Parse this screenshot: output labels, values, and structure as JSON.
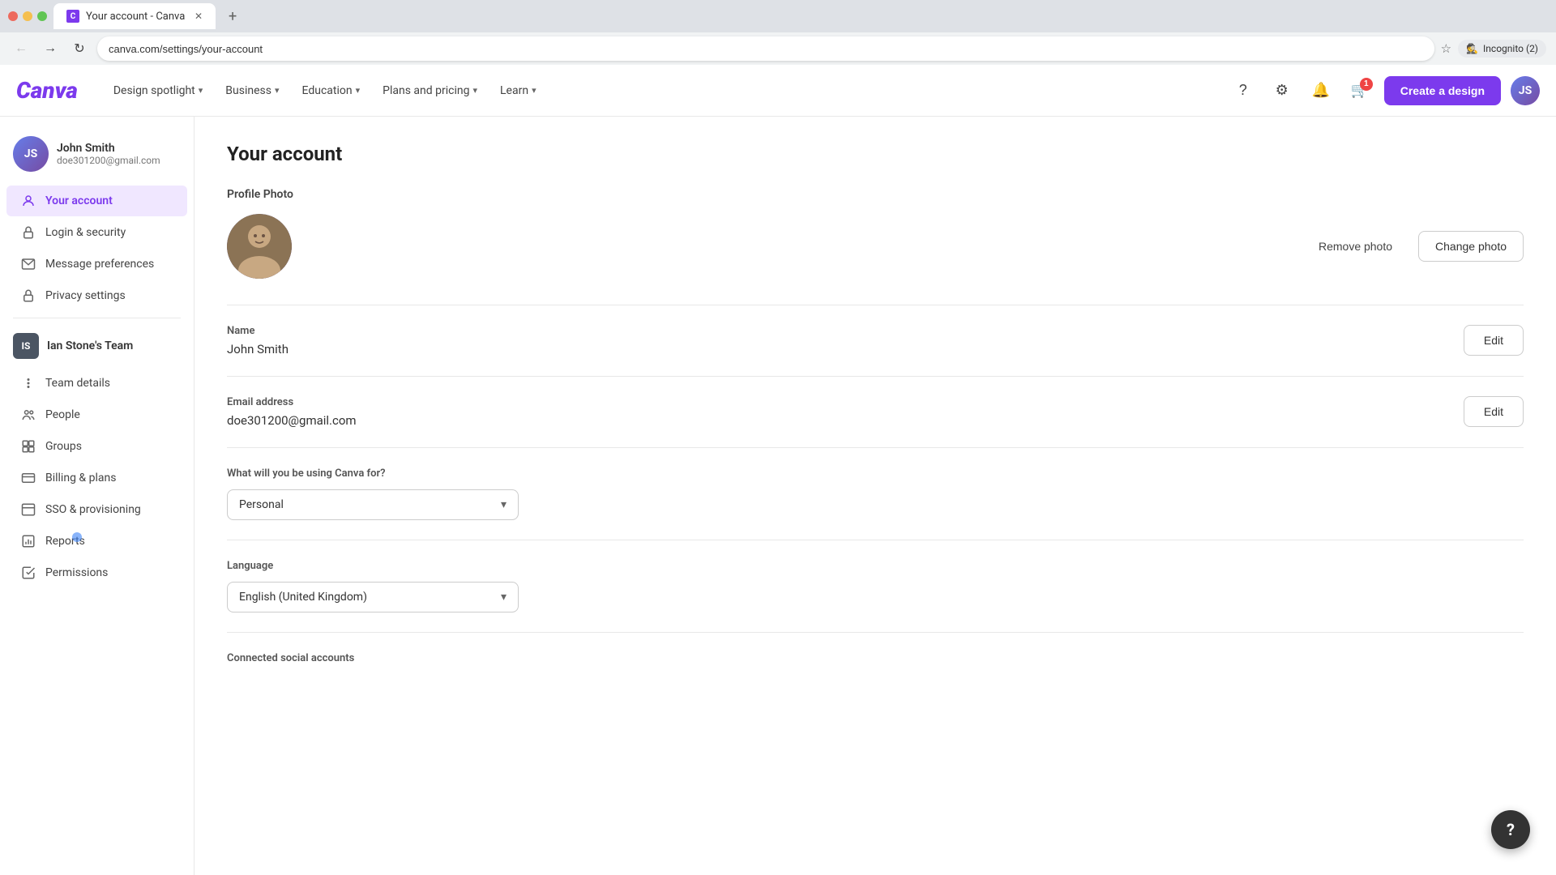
{
  "browser": {
    "tab_title": "Your account - Canva",
    "favicon_text": "C",
    "url": "canva.com/settings/your-account",
    "new_tab_label": "+",
    "nav": {
      "back_label": "←",
      "forward_label": "→",
      "refresh_label": "↻",
      "home_label": "⌂"
    },
    "incognito_label": "Incognito (2)"
  },
  "top_nav": {
    "logo": "Canva",
    "items": [
      {
        "label": "Design spotlight",
        "has_dropdown": true
      },
      {
        "label": "Business",
        "has_dropdown": true
      },
      {
        "label": "Education",
        "has_dropdown": true
      },
      {
        "label": "Plans and pricing",
        "has_dropdown": true
      },
      {
        "label": "Learn",
        "has_dropdown": true
      }
    ],
    "help_icon": "?",
    "settings_icon": "⚙",
    "bell_icon": "🔔",
    "cart_icon": "🛒",
    "cart_badge": "1",
    "create_btn": "Create a design"
  },
  "sidebar": {
    "user": {
      "name": "John Smith",
      "email": "doe301200@gmail.com",
      "avatar_initials": "JS"
    },
    "personal_items": [
      {
        "id": "your-account",
        "label": "Your account",
        "icon": "👤",
        "active": true
      },
      {
        "id": "login-security",
        "label": "Login & security",
        "icon": "🔒"
      },
      {
        "id": "message-preferences",
        "label": "Message preferences",
        "icon": "✉"
      },
      {
        "id": "privacy-settings",
        "label": "Privacy settings",
        "icon": "🔐"
      }
    ],
    "team": {
      "initials": "IS",
      "name": "Ian Stone's Team"
    },
    "team_items": [
      {
        "id": "team-details",
        "label": "Team details",
        "icon": "⋮"
      },
      {
        "id": "people",
        "label": "People",
        "icon": "👥"
      },
      {
        "id": "groups",
        "label": "Groups",
        "icon": "⊞"
      },
      {
        "id": "billing-plans",
        "label": "Billing & plans",
        "icon": "💳"
      },
      {
        "id": "sso-provisioning",
        "label": "SSO & provisioning",
        "icon": "⊟"
      },
      {
        "id": "reports",
        "label": "Reports",
        "icon": "📊"
      },
      {
        "id": "permissions",
        "label": "Permissions",
        "icon": "☑"
      }
    ]
  },
  "main": {
    "page_title": "Your account",
    "profile_photo": {
      "label": "Profile Photo",
      "remove_btn": "Remove photo",
      "change_btn": "Change photo"
    },
    "name_field": {
      "label": "Name",
      "value": "John Smith",
      "edit_btn": "Edit"
    },
    "email_field": {
      "label": "Email address",
      "value": "doe301200@gmail.com",
      "edit_btn": "Edit"
    },
    "usage_field": {
      "label": "What will you be using Canva for?",
      "value": "Personal"
    },
    "language_field": {
      "label": "Language",
      "value": "English (United Kingdom)"
    },
    "social_section": {
      "label": "Connected social accounts"
    }
  },
  "help_fab": "?"
}
